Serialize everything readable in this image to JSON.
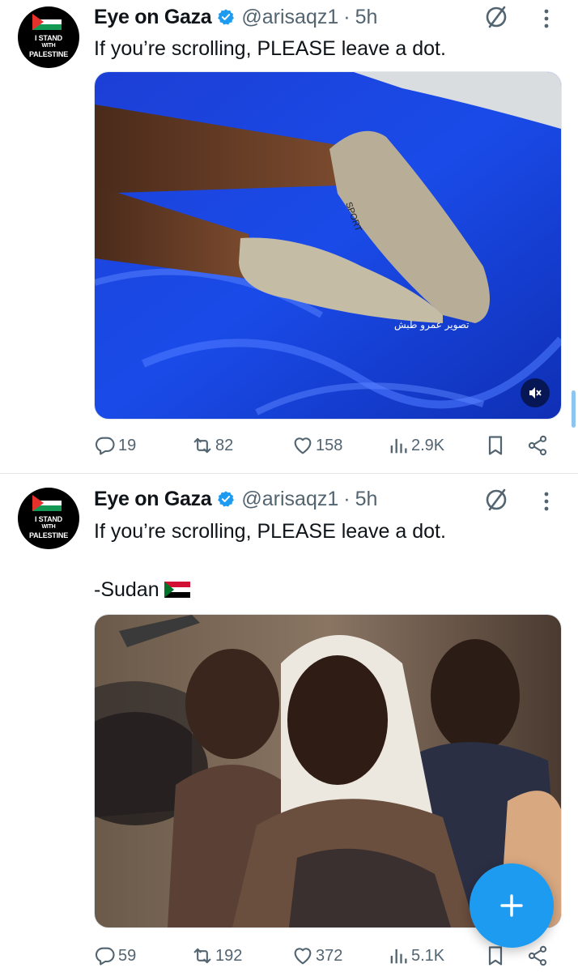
{
  "colors": {
    "accent": "#1d9bf0",
    "text": "#0f1419",
    "muted": "#536471",
    "verified": "#1d9bf0"
  },
  "tweets": [
    {
      "avatar_text": [
        "I STAND",
        "WITH",
        "PALESTINE"
      ],
      "display_name": "Eye on Gaza",
      "handle": "@arisaqz1",
      "separator": "·",
      "time": "5h",
      "text": "If you’re scrolling, PLEASE leave a dot.",
      "extra_line": "",
      "media": {
        "kind": "photo",
        "overlay_caption": "تصوير عمرو طبش",
        "has_mute_button": true
      },
      "stats": {
        "replies": "19",
        "reposts": "82",
        "likes": "158",
        "views": "2.9K"
      }
    },
    {
      "avatar_text": [
        "I STAND",
        "WITH",
        "PALESTINE"
      ],
      "display_name": "Eye on Gaza",
      "handle": "@arisaqz1",
      "separator": "·",
      "time": "5h",
      "text": "If you’re scrolling, PLEASE leave a dot.",
      "extra_line": "-Sudan",
      "extra_emoji": "sudan-flag",
      "media": {
        "kind": "photo",
        "overlay_caption": "",
        "has_mute_button": false
      },
      "stats": {
        "replies": "59",
        "reposts": "192",
        "likes": "372",
        "views": "5.1K"
      }
    }
  ],
  "icons": {
    "reply": "reply-icon",
    "repost": "repost-icon",
    "like": "heart-icon",
    "views": "views-icon",
    "bookmark": "bookmark-icon",
    "share": "share-icon",
    "grok": "grok-icon",
    "more": "more-vertical-icon",
    "compose": "plus-icon"
  }
}
